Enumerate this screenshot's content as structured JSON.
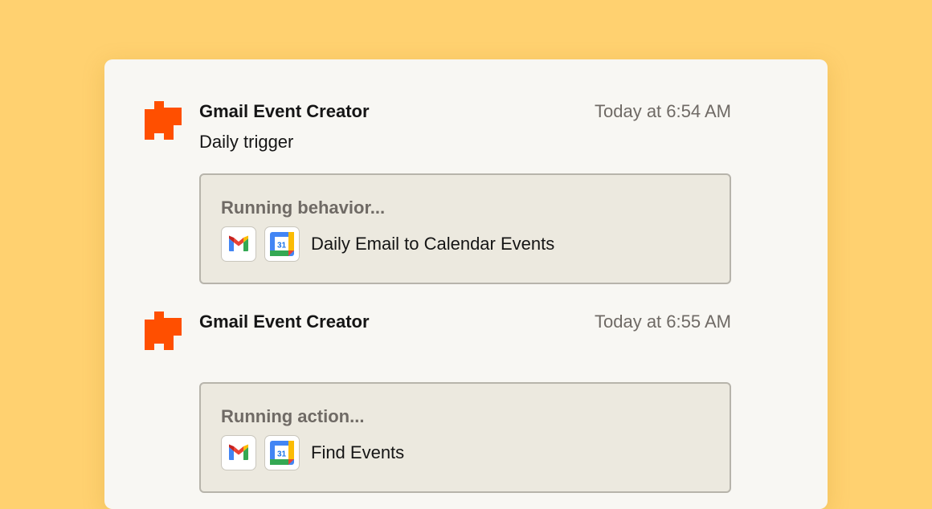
{
  "messages": [
    {
      "sender": "Gmail Event Creator",
      "time": "Today at 6:54 AM",
      "subtext": "Daily trigger",
      "run": {
        "label": "Running behavior...",
        "apps": [
          "gmail-icon",
          "google-calendar-icon"
        ],
        "name": "Daily Email to Calendar Events"
      }
    },
    {
      "sender": "Gmail Event Creator",
      "time": "Today at 6:55 AM",
      "run": {
        "label": "Running action...",
        "apps": [
          "gmail-icon",
          "google-calendar-icon"
        ],
        "name": "Find Events"
      }
    }
  ],
  "icons": {
    "avatar": "zapier-asterisk-icon",
    "calendar_day": "31"
  },
  "colors": {
    "background": "#ffd170",
    "card": "#f8f7f3",
    "avatar_orange": "#ff4f00",
    "run_box": "#ece9df",
    "muted_text": "#6f6a65"
  }
}
